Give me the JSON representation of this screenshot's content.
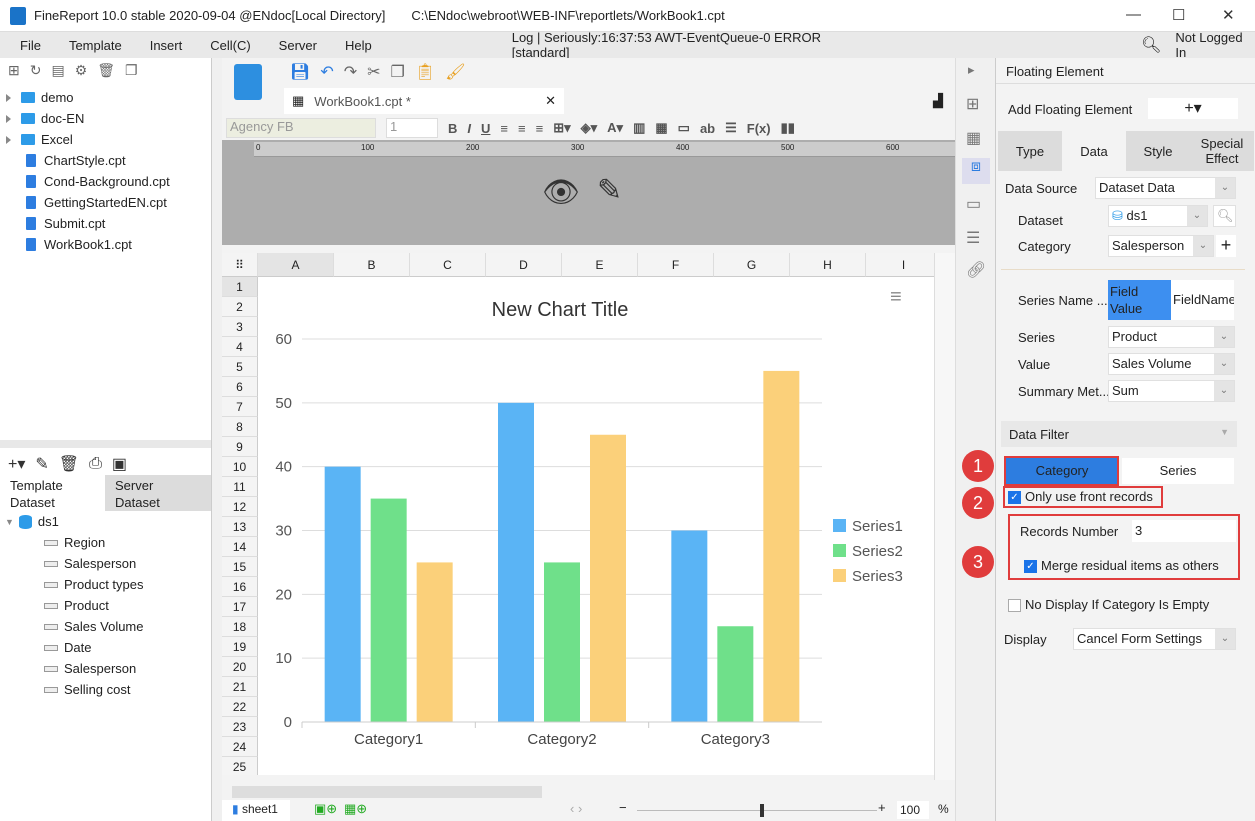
{
  "title": {
    "app": "FineReport 10.0 stable 2020-09-04 @ENdoc[Local Directory]",
    "path": "C:\\ENdoc\\webroot\\WEB-INF\\reportlets/WorkBook1.cpt"
  },
  "menu": [
    "File",
    "Template",
    "Insert",
    "Cell(C)",
    "Server",
    "Help"
  ],
  "log": "Log | Seriously:16:37:53 AWT-EventQueue-0 ERROR [standard]",
  "login": "Not Logged In",
  "tree": {
    "folders": [
      "demo",
      "doc-EN",
      "Excel"
    ],
    "files": [
      "ChartStyle.cpt",
      "Cond-Background.cpt",
      "GettingStartedEN.cpt",
      "Submit.cpt",
      "WorkBook1.cpt"
    ]
  },
  "dataset_tabs": [
    "Template Dataset",
    "Server Dataset"
  ],
  "dataset": {
    "name": "ds1",
    "fields": [
      "Region",
      "Salesperson",
      "Product types",
      "Product",
      "Sales Volume",
      "Date",
      "Salesperson",
      "Selling cost"
    ]
  },
  "editor": {
    "tab": "WorkBook1.cpt *",
    "font": "Agency FB",
    "size": "1",
    "ruler": [
      "0",
      "100",
      "200",
      "300",
      "400",
      "500",
      "600"
    ]
  },
  "columns": [
    "A",
    "B",
    "C",
    "D",
    "E",
    "F",
    "G",
    "H",
    "I"
  ],
  "rows": [
    "1",
    "2",
    "3",
    "4",
    "5",
    "6",
    "7",
    "8",
    "9",
    "10",
    "11",
    "12",
    "13",
    "14",
    "15",
    "16",
    "17",
    "18",
    "19",
    "20",
    "21",
    "22",
    "23",
    "24",
    "25"
  ],
  "chart_data": {
    "type": "bar",
    "title": "New Chart Title",
    "categories": [
      "Category1",
      "Category2",
      "Category3"
    ],
    "series": [
      {
        "name": "Series1",
        "values": [
          40,
          50,
          30
        ],
        "color": "#5ab4f5"
      },
      {
        "name": "Series2",
        "values": [
          35,
          25,
          15
        ],
        "color": "#6fe08a"
      },
      {
        "name": "Series3",
        "values": [
          25,
          45,
          55
        ],
        "color": "#fbd07a"
      }
    ],
    "ylim": [
      0,
      60
    ],
    "yticks": [
      "0",
      "10",
      "20",
      "30",
      "40",
      "50",
      "60"
    ],
    "legend": "right",
    "grid": true
  },
  "bottom": {
    "sheet": "sheet1",
    "zoom": "100",
    "percent": "%",
    "zoom_level": 100
  },
  "panel": {
    "title": "Floating Element",
    "add_label": "Add Floating Element",
    "tabs": [
      "Type",
      "Data",
      "Style",
      "Special Effect"
    ],
    "data_source_label": "Data Source",
    "data_source": "Dataset Data",
    "dataset_label": "Dataset",
    "dataset": "ds1",
    "category_label": "Category",
    "category": "Salesperson",
    "series_name_label": "Series Name ...",
    "field_value": "Field Value",
    "field_name": "FieldName",
    "series_label": "Series",
    "series": "Product",
    "value_label": "Value",
    "value": "Sales Volume",
    "summary_label": "Summary Met...",
    "summary": "Sum",
    "filter_label": "Data Filter",
    "filter_tabs": [
      "Category",
      "Series"
    ],
    "front_records": "Only use front records",
    "records_label": "Records Number",
    "records": "3",
    "merge": "Merge residual items as others",
    "no_display": "No Display If Category Is Empty",
    "display_label": "Display",
    "display": "Cancel Form Settings"
  },
  "badges": [
    "1",
    "2",
    "3"
  ]
}
